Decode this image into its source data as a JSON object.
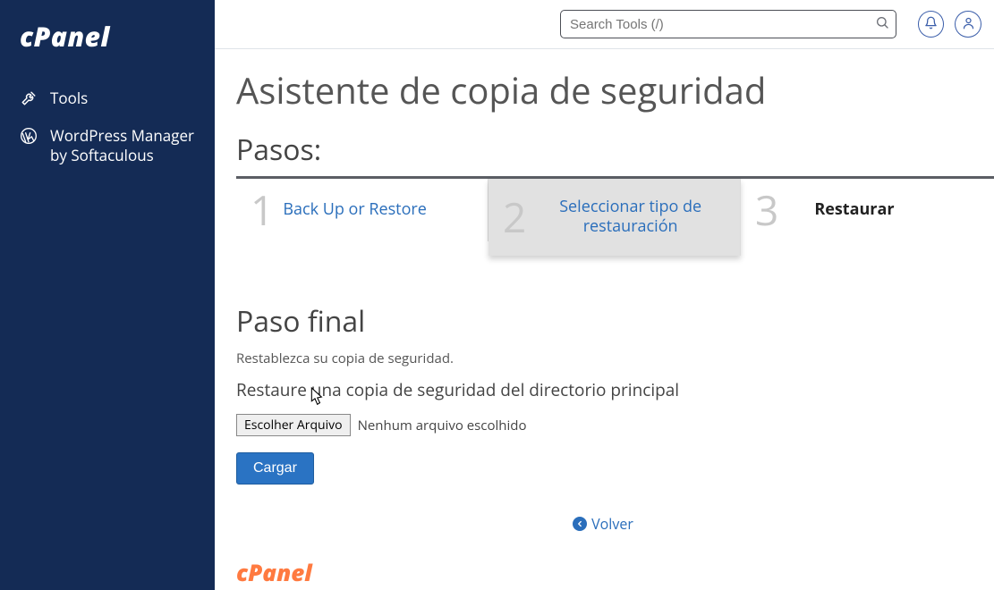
{
  "sidebar": {
    "logo_text": "cPanel",
    "items": [
      {
        "label": "Tools",
        "icon": "tools-icon"
      },
      {
        "label": "WordPress Manager by Softaculous",
        "icon": "wordpress-icon"
      }
    ]
  },
  "header": {
    "search_placeholder": "Search Tools (/)"
  },
  "page": {
    "title": "Asistente de copia de seguridad",
    "steps_title": "Pasos:",
    "steps": [
      {
        "num": "1",
        "label": "Back Up or Restore"
      },
      {
        "num": "2",
        "label": "Seleccionar tipo de restauración"
      },
      {
        "num": "3",
        "label": "Restaurar"
      }
    ],
    "final": {
      "title": "Paso final",
      "subtitle": "Restablezca su copia de seguridad.",
      "restore_text": "Restaure una copia de seguridad del directorio principal",
      "file_button": "Escolher Arquivo",
      "file_status": "Nenhum arquivo escolhido",
      "upload_button": "Cargar"
    },
    "back_label": "Volver",
    "footer_logo": "cPanel"
  }
}
